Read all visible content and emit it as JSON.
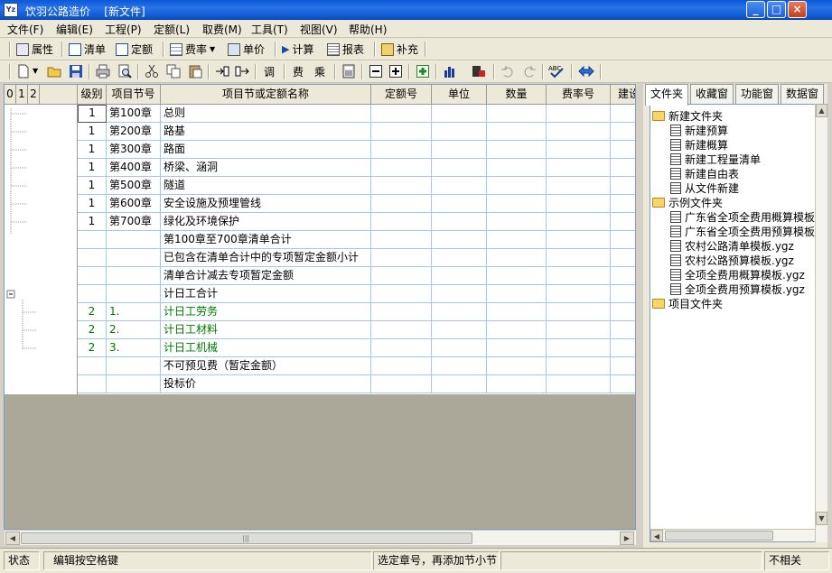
{
  "titlebar": {
    "app": "饮羽公路造价",
    "doc": "[新文件]",
    "app_icon_text": "Yz"
  },
  "window": {
    "minimize": "_",
    "maximize": "□",
    "close": "×"
  },
  "menu": [
    "文件(F)",
    "编辑(E)",
    "工程(P)",
    "定额(L)",
    "取费(M)",
    "工具(T)",
    "视图(V)",
    "帮助(H)"
  ],
  "toolbar1": {
    "properties": "属性",
    "bill": "清单",
    "quota": "定额",
    "rate": "费率",
    "unit_price": "单价",
    "calculate": "计算",
    "report": "报表",
    "supplement": "补充"
  },
  "toolbar2": {
    "tune": "调",
    "fee": "费",
    "multiply": "乘"
  },
  "grid": {
    "tree_levels": [
      "0",
      "1",
      "2"
    ],
    "columns": [
      "级别",
      "项目节号",
      "项目节或定额名称",
      "定额号",
      "单位",
      "数量",
      "费率号",
      "建设"
    ],
    "rows": [
      {
        "level": "1",
        "code": "第100章",
        "name": "总则",
        "green": false
      },
      {
        "level": "1",
        "code": "第200章",
        "name": "路基",
        "green": false
      },
      {
        "level": "1",
        "code": "第300章",
        "name": "路面",
        "green": false
      },
      {
        "level": "1",
        "code": "第400章",
        "name": "桥梁、涵洞",
        "green": false
      },
      {
        "level": "1",
        "code": "第500章",
        "name": "隧道",
        "green": false
      },
      {
        "level": "1",
        "code": "第600章",
        "name": "安全设施及预埋管线",
        "green": false
      },
      {
        "level": "1",
        "code": "第700章",
        "name": "绿化及环境保护",
        "green": false
      },
      {
        "level": "",
        "code": "",
        "name": "第100章至700章清单合计",
        "green": false
      },
      {
        "level": "",
        "code": "",
        "name": "已包含在清单合计中的专项暂定金额小计",
        "green": false
      },
      {
        "level": "",
        "code": "",
        "name": "清单合计减去专项暂定金额",
        "green": false
      },
      {
        "level": "",
        "code": "",
        "name": "计日工合计",
        "green": false
      },
      {
        "level": "2",
        "code": "1.",
        "name": "计日工劳务",
        "green": true
      },
      {
        "level": "2",
        "code": "2.",
        "name": "计日工材料",
        "green": true
      },
      {
        "level": "2",
        "code": "3.",
        "name": "计日工机械",
        "green": true
      },
      {
        "level": "",
        "code": "",
        "name": "不可预见费（暂定金额）",
        "green": false
      },
      {
        "level": "",
        "code": "",
        "name": "投标价",
        "green": false
      }
    ]
  },
  "side": {
    "tabs": [
      "文件夹",
      "收藏窗",
      "功能窗",
      "数据窗"
    ],
    "tree": [
      {
        "label": "新建文件夹",
        "kind": "folder",
        "depth": 0
      },
      {
        "label": "新建预算",
        "kind": "doc",
        "depth": 1
      },
      {
        "label": "新建概算",
        "kind": "doc",
        "depth": 1
      },
      {
        "label": "新建工程量清单",
        "kind": "doc",
        "depth": 1
      },
      {
        "label": "新建自由表",
        "kind": "doc",
        "depth": 1
      },
      {
        "label": "从文件新建",
        "kind": "doc",
        "depth": 1
      },
      {
        "label": "示例文件夹",
        "kind": "folder",
        "depth": 0
      },
      {
        "label": "广东省全项全费用概算模板.",
        "kind": "doc",
        "depth": 1
      },
      {
        "label": "广东省全项全费用预算模板.",
        "kind": "doc",
        "depth": 1
      },
      {
        "label": "农村公路清单模板.ygz",
        "kind": "doc",
        "depth": 1
      },
      {
        "label": "农村公路预算模板.ygz",
        "kind": "doc",
        "depth": 1
      },
      {
        "label": "全项全费用概算模板.ygz",
        "kind": "doc",
        "depth": 1
      },
      {
        "label": "全项全费用预算模板.ygz",
        "kind": "doc",
        "depth": 1
      },
      {
        "label": "项目文件夹",
        "kind": "folder",
        "depth": 0
      }
    ]
  },
  "status": {
    "state": "状态",
    "hint": "编辑按空格键",
    "message": "选定章号，再添加节小节",
    "extra": "",
    "right": "不相关"
  },
  "colors": {
    "green_text": "#007800",
    "title_blue": "#0a58d8"
  }
}
